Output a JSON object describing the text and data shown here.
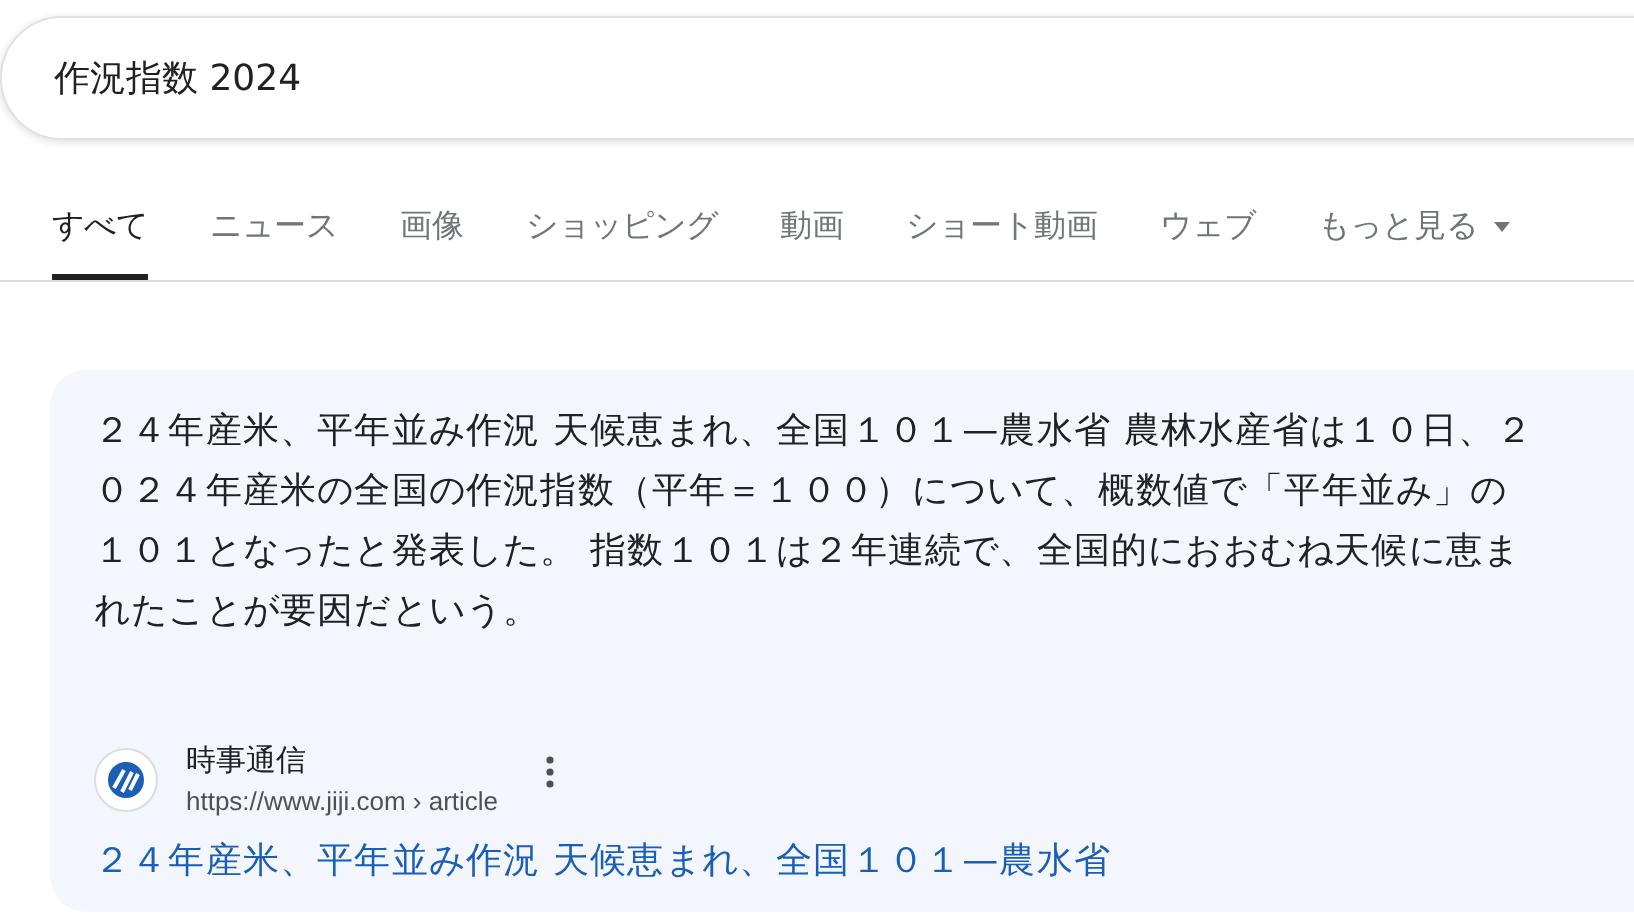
{
  "search": {
    "value": "作況指数 2024"
  },
  "tabs": [
    {
      "label": "すべて",
      "selected": true
    },
    {
      "label": "ニュース",
      "selected": false
    },
    {
      "label": "画像",
      "selected": false
    },
    {
      "label": "ショッピング",
      "selected": false
    },
    {
      "label": "動画",
      "selected": false
    },
    {
      "label": "ショート動画",
      "selected": false
    },
    {
      "label": "ウェブ",
      "selected": false
    },
    {
      "label": "もっと見る",
      "selected": false,
      "kind": "menu"
    }
  ],
  "result": {
    "snippet": "２４年産米、平年並み作況 天候恵まれ、全国１０１—農水省 農林水産省は１０日、２０２４年産米の全国の作況指数（平年＝１００）について、概数値で「平年並み」の１０１となったと発表した。 指数１０１は２年連続で、全国的におおむね天候に恵まれたことが要因だという。",
    "source": "時事通信",
    "url": "https://www.jiji.com › article",
    "title": "２４年産米、平年並み作況 天候恵まれ、全国１０１—農水省"
  }
}
